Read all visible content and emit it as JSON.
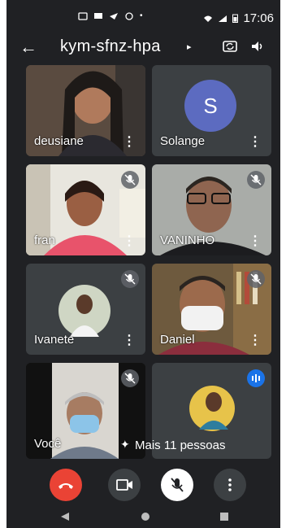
{
  "status_bar": {
    "time": "17:06"
  },
  "meeting": {
    "code": "kym-sfnz-hpa"
  },
  "participants": [
    {
      "name": "deusiane"
    },
    {
      "name": "Solange",
      "initial": "S"
    },
    {
      "name": "fran"
    },
    {
      "name": "VANINHO"
    },
    {
      "name": "Ivanete"
    },
    {
      "name": "Daniel"
    },
    {
      "name": "Você"
    }
  ],
  "more_people": "Mais 11 pessoas",
  "icons": {
    "back": "arrow-left-icon",
    "caret": "caret-right-icon",
    "camera_switch": "camera-switch-icon",
    "speaker": "speaker-icon",
    "mic_off": "mic-off-icon",
    "more": "more-vert-icon",
    "end_call": "end-call-icon",
    "video": "video-icon",
    "nav_back": "triangle-back-icon",
    "nav_home": "circle-home-icon",
    "nav_recent": "square-recent-icon"
  },
  "colors": {
    "end_call": "#ea4335",
    "avatar": "#5c6bc0",
    "background": "#202124",
    "tile": "#3c4043",
    "active_speaker": "#1a73e8"
  }
}
